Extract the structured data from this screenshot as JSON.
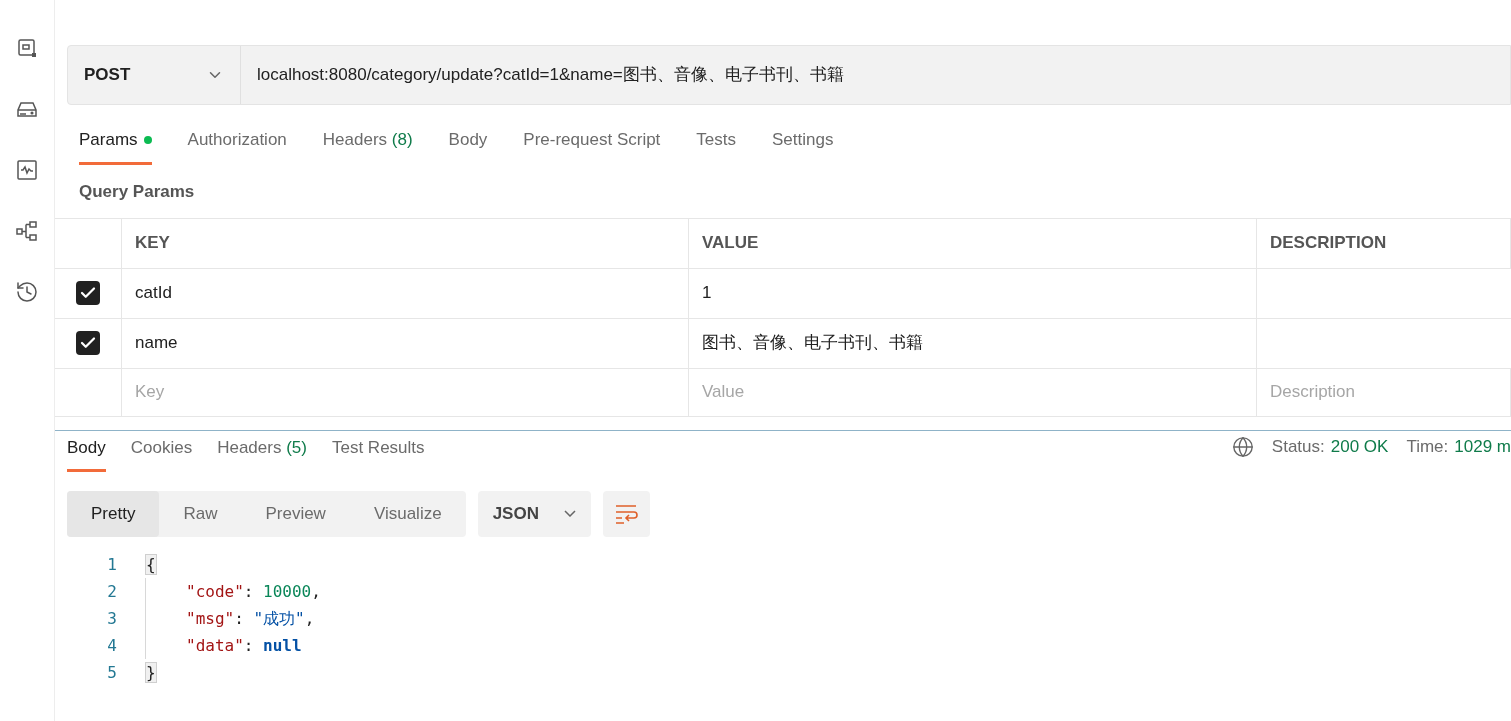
{
  "request": {
    "method": "POST",
    "url": "localhost:8080/category/update?catId=1&name=图书、音像、电子书刊、书籍"
  },
  "tabs": [
    {
      "label": "Params",
      "dot": true,
      "selected": true
    },
    {
      "label": "Authorization",
      "dot": false,
      "selected": false
    },
    {
      "label": "Headers",
      "count": "(8)",
      "dot": false,
      "selected": false
    },
    {
      "label": "Body",
      "dot": false,
      "selected": false
    },
    {
      "label": "Pre-request Script",
      "dot": false,
      "selected": false
    },
    {
      "label": "Tests",
      "dot": false,
      "selected": false
    },
    {
      "label": "Settings",
      "dot": false,
      "selected": false
    }
  ],
  "query_params": {
    "title": "Query Params",
    "columns": [
      "KEY",
      "VALUE",
      "DESCRIPTION"
    ],
    "rows": [
      {
        "key": "catId",
        "value": "1",
        "checked": true
      },
      {
        "key": "name",
        "value": "图书、音像、电子书刊、书籍",
        "checked": true
      }
    ],
    "placeholders": [
      "Key",
      "Value",
      "Description"
    ]
  },
  "response": {
    "tabs": [
      {
        "label": "Body",
        "selected": true
      },
      {
        "label": "Cookies",
        "selected": false
      },
      {
        "label": "Headers",
        "count": "(5)",
        "selected": false
      },
      {
        "label": "Test Results",
        "selected": false
      }
    ],
    "status_label": "Status:",
    "status": "200 OK",
    "time_label": "Time:",
    "time": "1029 m",
    "view_modes": [
      {
        "label": "Pretty",
        "selected": true
      },
      {
        "label": "Raw",
        "selected": false
      },
      {
        "label": "Preview",
        "selected": false
      },
      {
        "label": "Visualize",
        "selected": false
      }
    ],
    "format": "JSON",
    "lines": [
      {
        "number": "1",
        "indent": false,
        "tokens": [
          {
            "kind": "brace",
            "text": "{"
          }
        ]
      },
      {
        "number": "2",
        "indent": true,
        "tokens": [
          {
            "kind": "key",
            "text": "\"code\""
          },
          {
            "kind": "punct",
            "text": ": "
          },
          {
            "kind": "number",
            "text": "10000"
          },
          {
            "kind": "punct",
            "text": ","
          }
        ]
      },
      {
        "number": "3",
        "indent": true,
        "tokens": [
          {
            "kind": "key",
            "text": "\"msg\""
          },
          {
            "kind": "punct",
            "text": ": "
          },
          {
            "kind": "string",
            "text": "\"成功\""
          },
          {
            "kind": "punct",
            "text": ","
          }
        ]
      },
      {
        "number": "4",
        "indent": true,
        "tokens": [
          {
            "kind": "key",
            "text": "\"data\""
          },
          {
            "kind": "punct",
            "text": ": "
          },
          {
            "kind": "keyword",
            "text": "null"
          }
        ]
      },
      {
        "number": "5",
        "indent": false,
        "tokens": [
          {
            "kind": "brace",
            "text": "}"
          }
        ]
      }
    ]
  }
}
